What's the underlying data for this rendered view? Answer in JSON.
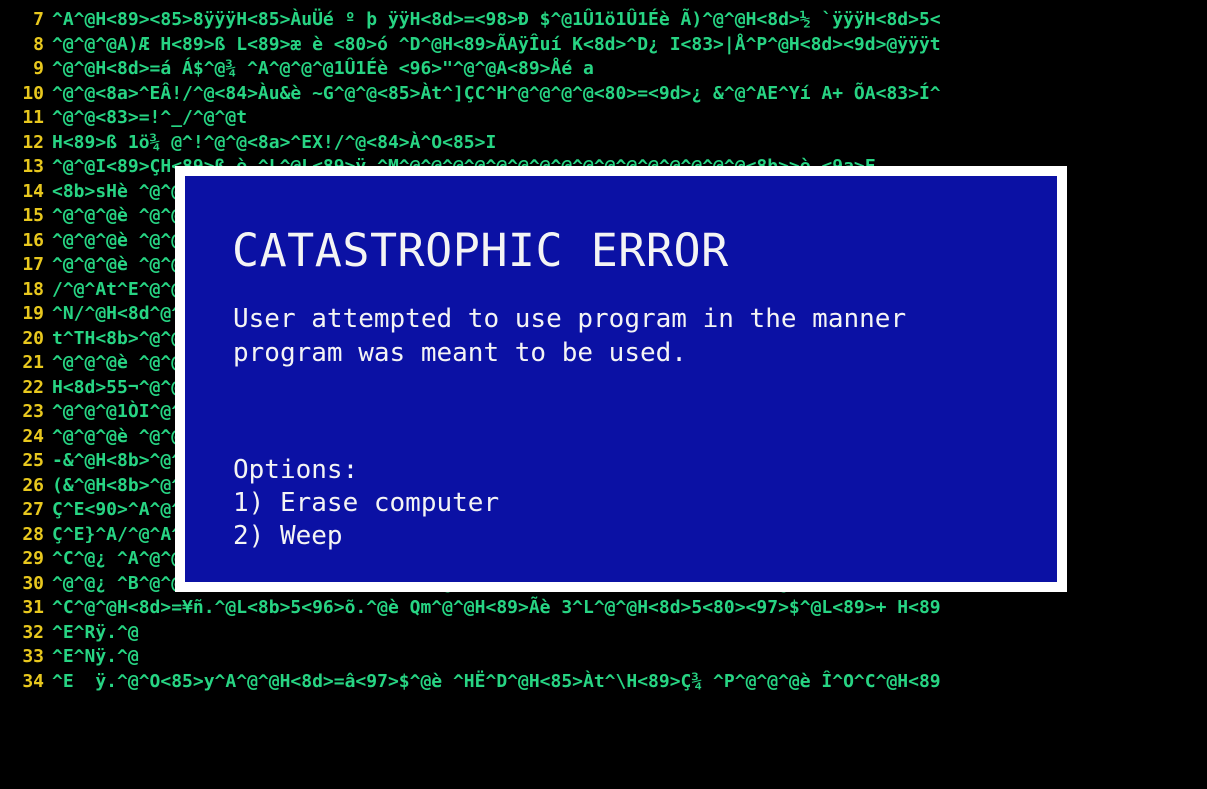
{
  "terminal": {
    "lines": [
      {
        "num": "7",
        "text": "^A^@H<89><85>8ÿÿÿH<85>ÀuÜé º þ ÿÿH<8d>=<98>Ð $^@1Û1ö1Û1Éè Ã)^@^@H<8d>½ `ÿÿÿH<8d>5<"
      },
      {
        "num": "8",
        "text": "^@^@^@A)Æ H<89>ß L<89>æ è <80>ó ^D^@H<89>ÃAÿÎuí K<8d>^D¿ I<83>|Å^P^@H<8d><9d>@ÿÿÿt"
      },
      {
        "num": "9",
        "text": "^@^@H<8d>=á Á$^@¾ ^A^@^@^@1Û1Éè <96>\"^@^@A<89>Åé a"
      },
      {
        "num": "10",
        "text": "^@^@<8a>^EÂ!/^@<84>Àu&è ~G^@^@<85>Àt^]ÇC^H^@^@^@^@<80>=<9d>¿ &^@^AE^Yí A+ ÕA<83>Í^"
      },
      {
        "num": "11",
        "text": "^@^@<83>=!^_/^@^@t"
      },
      {
        "num": "12",
        "text": "H<89>ß 1ö¾ @^!^@^@<8a>^EX!/^@<84>À^O<85>I"
      },
      {
        "num": "13",
        "text": "^@^@I<89>ÇH<89>ß è ^L^@L<89>ÿ ^M^@^@^@^@^@^@^@^@^@^@^@^@^@^@^@^@<8b>>è <9a>F"
      },
      {
        "num": "14",
        "text": "<8b>sHè ^@^@^@^@^@^@^@^@^@^@^@^@^@^@^@^@^@^@^@^@^@^@^@^@^@^@^@^@é Á$^@è 3E"
      },
      {
        "num": "15",
        "text": "^@^@^@è ^@^@^@^@^@^@^@^@^@^@^@^@^@^@^@^@^@^@^@^@^@^@^@^@^@^@^@^@^@^@^@^@<8a>"
      },
      {
        "num": "16",
        "text": "^@^@^@è ^@^@^@^@^@^@^@^@^@^@^@^@^@^@^@^@^@^@^@^@^@^@^@^@^@^@^@^@<89>ß H<8d>"
      },
      {
        "num": "17",
        "text": "^@^@^@è ^@^@^@^@^@^@^@^@^@^@^@^@^@^@^@^@^@^@^@^@^@^@^@^@^@^@^@^@X/^@L<89>õ"
      },
      {
        "num": "18",
        "text": "/^@^At^E^@^@^@^@^@^@^@^@^@^@^@^@^@^@^@^@^@^@^@^@^@^@^@^@^@^@^@^@A^@^@[A\\A]"
      },
      {
        "num": "19",
        "text": "^N/^@H<8d^@^@^@^@^@^@^@^@^@^@^@^@^@^@^@^@^@^@^@^@^@^@^@^@^@^@^@<8d>5ì µ$^"
      },
      {
        "num": "20",
        "text": "t^TH<8b>^@^@^@^@^@^@^@^@^@^@^@^@^@^@^@^@^@^@^@^@^@^@^@^@^@^@^@^@^@^@^@^@"
      },
      {
        "num": "21",
        "text": "^@^@^@è ^@^@^@^@^@^@^@^@^@^@^@^@^@^@^@^@^@^@^@^@^@^@^@^@^@^@^@^@>åSPH<89>+"
      },
      {
        "num": "22",
        "text": "H<8d>55¬^@^@^@^@^@^@^@^@^@^@^@^@^@^@^@^@^@^@^@^@^@^@^@^@^@^@^@^@ÃUH<89>åAW"
      },
      {
        "num": "23",
        "text": "^@^@^@1ÒI^@^@^@^@^@^@^@^@^@^@^@^@^@^@^@^@^@^@^@^@^@^@^@^@^@^@^@ ^D^@f^O|À"
      },
      {
        "num": "24",
        "text": "^@^@^@è ^@^@^@^@^@^@^@^@^@^@^@^@^@^@^@^@^@^@^@^@^@^@^@^@^@^@^@^@H<8d>5ê §"
      },
      {
        "num": "25",
        "text": "-&^@H<8b>^@^@^@^@^@^@^@^@^@^@^@^@^@^@^@^@^@^@^@^@^@^@^@^@^@^@^@^@ ¸ ^U^@^@ë"
      },
      {
        "num": "26",
        "text": "(&^@H<8b>^@^@^@^@^@^@^@^@^@^@^@^@^@^@^@^@^@^@^@^@^@^@^@^@^@^@^@^@MÐ è ¶ ® ^"
      },
      {
        "num": "27",
        "text": "Ç^E<90>^A^@^@^@^@^@^@^@^@^@^@^@^@^@^@^@^@^@^@^@^@^@^@^@^@^@^@^@^@^@^@^@^@"
      },
      {
        "num": "28",
        "text": "Ç^E}^A/^@^A^@^@^@<80>=w^H/^@^@t^G<80>^M¶ ¡ &^@^Aõ^E<86>ø .^@^AtCH<8b>^Euø .^@H<85>"
      },
      {
        "num": "29",
        "text": "^C^@¿ ^A^@^@^@è (Ì^D^@H<8d>=}+ .^@¾ ^@^B^@^@è <97>M^@^@H<8d>=$ò .^@¾ <80>^@^@^@è A"
      },
      {
        "num": "30",
        "text": "^@^@¿ ^B^@^@^@è ½ Í^D^@H<8d>5w^H^@^@¿ ^C^@^@^@è ¬Í^D^@H<8d>53^L^@^@¿ ^\\^@^@^@è <9b"
      },
      {
        "num": "31",
        "text": "^C^@^@H<8d>=¥ñ.^@L<8b>5<96>õ.^@è Qm^@^@H<89>Ãè 3^L^@^@H<8d>5<80><97>$^@L<89>+ H<89"
      },
      {
        "num": "32",
        "text": "^E^Rÿ.^@"
      },
      {
        "num": "33",
        "text": "^E^Nÿ.^@"
      },
      {
        "num": "34",
        "text": "^E  ÿ.^@^O<85>y^A^@^@H<8d>=â<97>$^@è ^HË^D^@H<85>Àt^\\H<89>Ç¾ ^P^@^@^@è Î^O^C^@H<89"
      }
    ]
  },
  "dialog": {
    "title": "CATASTROPHIC ERROR",
    "message": "User attempted to use program in the manner\nprogram was meant to be used.",
    "options_label": "Options:",
    "options": [
      "1) Erase computer",
      "2) Weep"
    ]
  },
  "colors": {
    "terminal_bg": "#000000",
    "line_number": "#e8c81e",
    "code_text": "#27d483",
    "dialog_border": "#ffffff",
    "dialog_bg": "#0b11a4",
    "dialog_text": "#f4f4f4"
  }
}
